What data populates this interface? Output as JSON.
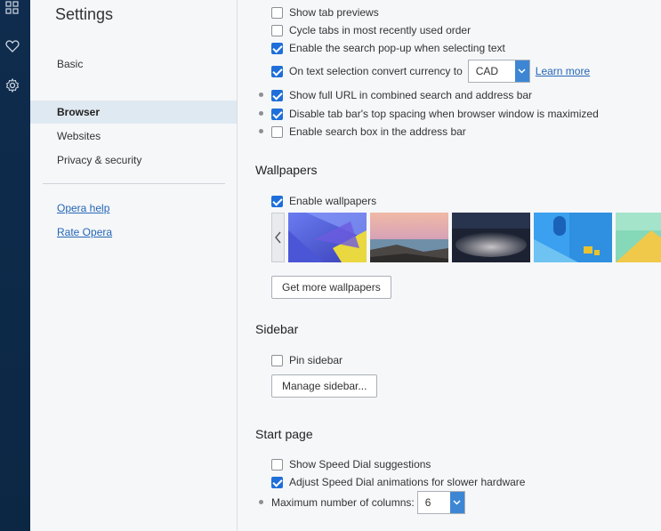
{
  "app": {
    "title": "Settings"
  },
  "sidebar": {
    "items": [
      {
        "label": "Basic",
        "active": false
      },
      {
        "label": "Browser",
        "active": true
      },
      {
        "label": "Websites",
        "active": false
      },
      {
        "label": "Privacy & security",
        "active": false
      }
    ],
    "links": [
      {
        "label": "Opera help"
      },
      {
        "label": "Rate Opera"
      }
    ]
  },
  "rail": {
    "icons": [
      "apps-icon",
      "heart-icon",
      "gear-icon"
    ]
  },
  "browser_options": {
    "show_tab_previews": {
      "label": "Show tab previews",
      "checked": false
    },
    "cycle_tabs": {
      "label": "Cycle tabs in most recently used order",
      "checked": false
    },
    "search_popup": {
      "label": "Enable the search pop-up when selecting text",
      "checked": true
    },
    "convert_currency": {
      "label": "On text selection convert currency to",
      "checked": true,
      "currency": "CAD",
      "learn_more": "Learn more"
    },
    "full_url": {
      "label": "Show full URL in combined search and address bar",
      "checked": true
    },
    "tab_spacing": {
      "label": "Disable tab bar's top spacing when browser window is maximized",
      "checked": true
    },
    "search_box": {
      "label": "Enable search box in the address bar",
      "checked": false
    }
  },
  "wallpapers": {
    "heading": "Wallpapers",
    "enable": {
      "label": "Enable wallpapers",
      "checked": true
    },
    "get_more": "Get more wallpapers"
  },
  "sidebar_section": {
    "heading": "Sidebar",
    "pin": {
      "label": "Pin sidebar",
      "checked": false
    },
    "manage": "Manage sidebar..."
  },
  "start_page": {
    "heading": "Start page",
    "speed_dial_suggestions": {
      "label": "Show Speed Dial suggestions",
      "checked": false
    },
    "speed_dial_animations": {
      "label": "Adjust Speed Dial animations for slower hardware",
      "checked": true
    },
    "max_columns": {
      "label": "Maximum number of columns:",
      "value": "6"
    }
  },
  "colors": {
    "accent": "#1e6fd9",
    "rail": "#0f2c4e",
    "link": "#2366b6"
  }
}
